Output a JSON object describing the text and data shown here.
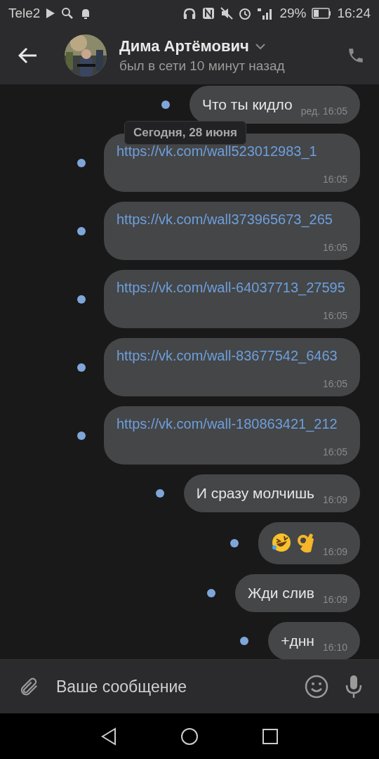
{
  "status_bar": {
    "carrier": "Tele2",
    "battery_percent": "29%",
    "time": "16:24"
  },
  "header": {
    "name": "Дима Артёмович",
    "status": "был в сети 10 минут назад"
  },
  "date_badge": "Сегодня, 28 июня",
  "messages": [
    {
      "kind": "text",
      "text": "Что ты кидло",
      "time": "ред. 16:05",
      "unread": true
    },
    {
      "kind": "link",
      "text": "https://vk.com/wall523012983_1",
      "time": "16:05",
      "unread": true
    },
    {
      "kind": "link",
      "text": "https://vk.com/wall373965673_265",
      "time": "16:05",
      "unread": true
    },
    {
      "kind": "link",
      "text": "https://vk.com/wall-64037713_27595",
      "time": "16:05",
      "unread": true
    },
    {
      "kind": "link",
      "text": "https://vk.com/wall-83677542_6463",
      "time": "16:05",
      "unread": true
    },
    {
      "kind": "link",
      "text": "https://vk.com/wall-180863421_212",
      "time": "16:05",
      "unread": true
    },
    {
      "kind": "text",
      "text": "И сразу молчишь",
      "time": "16:09",
      "unread": true
    },
    {
      "kind": "emoji",
      "time": "16:09",
      "unread": true
    },
    {
      "kind": "text",
      "text": "Жди слив",
      "time": "16:09",
      "unread": true
    },
    {
      "kind": "text",
      "text": "+днн",
      "time": "16:10",
      "unread": true
    }
  ],
  "composer": {
    "placeholder": "Ваше сообщение"
  }
}
